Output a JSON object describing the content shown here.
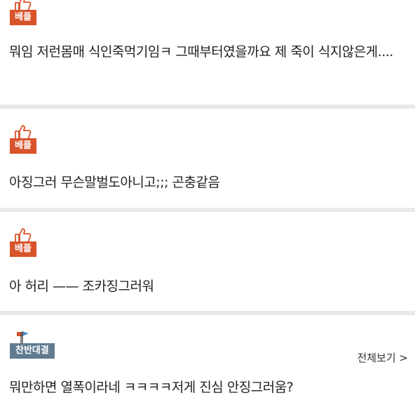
{
  "comments": [
    {
      "badge": "베플",
      "text": "뭐임 저런몸매 식인죽먹기임ㅋ 그때부터였을까요 제 죽이 식지않은게...."
    },
    {
      "badge": "베플",
      "text": "아징그러 무슨말벌도아니고;;; 곤충같음"
    },
    {
      "badge": "베플",
      "text": "아 허리 —— 조카징그러워"
    },
    {
      "badge": "찬반대결",
      "text": "뭐만하면 열폭이라네 ㅋㅋㅋㅋ저게 진심 안징그러움?",
      "see_all": "전체보기 >"
    }
  ],
  "colors": {
    "best_badge": "#d9532b",
    "vs_badge": "#607b8f"
  }
}
